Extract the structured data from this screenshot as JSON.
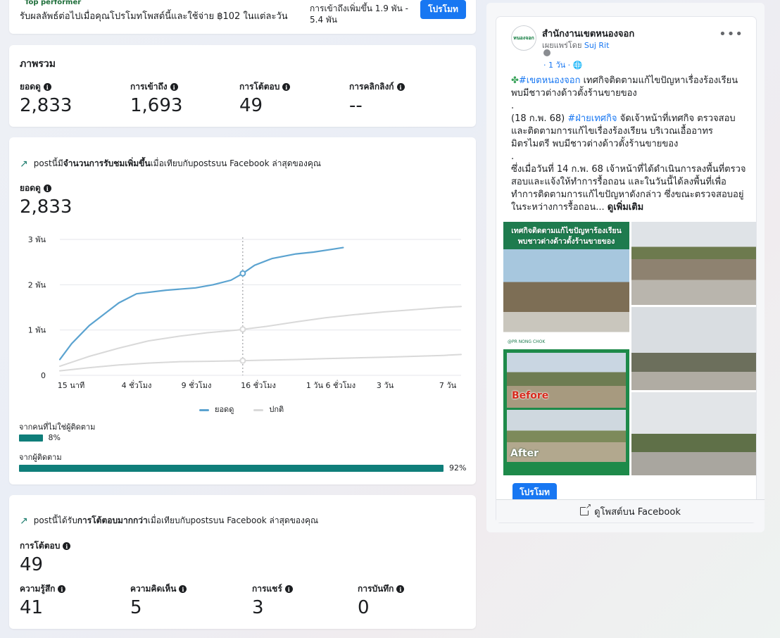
{
  "promo": {
    "tag": "Top performer",
    "text": "รับผลลัพธ์ต่อไปเมื่อคุณโปรโมทโพสต์นี้และใช้จ่าย ฿102 ในแต่ละวัน",
    "reach_line1": "การเข้าถึงเพิ่มขึ้น 1.9 พัน -",
    "reach_line2": "5.4 พัน",
    "button": "โปรโมท"
  },
  "overview": {
    "title": "ภาพรวม",
    "metrics": [
      {
        "label": "ยอดดู",
        "value": "2,833"
      },
      {
        "label": "การเข้าถึง",
        "value": "1,693"
      },
      {
        "label": "การโต้ตอบ",
        "value": "49"
      },
      {
        "label": "การคลิกลิงก์",
        "value": "--"
      }
    ]
  },
  "views_card": {
    "trend_pre": "postนี้มี",
    "trend_bold": "จำนวนการรับชมเพิ่มขึ้น",
    "trend_post": "เมื่อเทียบกับpostsบน Facebook ล่าสุดของคุณ",
    "metric_label": "ยอดดู",
    "metric_value": "2,833",
    "legend": {
      "series": "ยอดดู",
      "baseline": "ปกติ"
    },
    "non_followers_label": "จากคนที่ไม่ใช่ผู้ติดตาม",
    "non_followers_pct": "8%",
    "non_followers_value": 8,
    "followers_label": "จากผู้ติดตาม",
    "followers_pct": "92%",
    "followers_value": 92,
    "colors": {
      "series": "#5ba3d0",
      "baseline": "#d9d9d9",
      "bar": "#0f7e7a"
    }
  },
  "chart_data": {
    "type": "line",
    "x_tick_labels": [
      "15 นาที",
      "4 ชั่วโมง",
      "9 ชั่วโมง",
      "16 ชั่วโมง",
      "1 วัน 6 ชั่วโมง",
      "3 วัน",
      "7 วัน"
    ],
    "y_tick_labels": [
      "0",
      "1 พัน",
      "2 พัน",
      "3 พัน"
    ],
    "ylim": [
      0,
      3000
    ],
    "xlim": [
      0,
      6.8
    ],
    "series": [
      {
        "name": "ยอดดู",
        "x": [
          0,
          0.2,
          0.5,
          0.8,
          1.0,
          1.3,
          1.8,
          2.3,
          2.6,
          2.9,
          3.1,
          3.3,
          3.6,
          4.0,
          4.3,
          4.6,
          4.8
        ],
        "values": [
          350,
          700,
          1100,
          1400,
          1600,
          1800,
          1880,
          1930,
          2000,
          2100,
          2250,
          2430,
          2580,
          2680,
          2720,
          2780,
          2820
        ]
      },
      {
        "name": "ปกติ",
        "x": [
          0,
          0.5,
          1.0,
          1.5,
          2.0,
          2.5,
          3.0,
          3.5,
          4.0,
          4.5,
          5.0,
          5.5,
          6.0,
          6.5,
          6.8
        ],
        "values": [
          200,
          420,
          600,
          760,
          860,
          940,
          1000,
          1080,
          1180,
          1270,
          1340,
          1400,
          1450,
          1500,
          1520
        ]
      },
      {
        "name": "ปกติ",
        "x": [
          0,
          0.5,
          1.0,
          1.5,
          2.0,
          2.5,
          3.0,
          3.5,
          4.0,
          4.5,
          5.0,
          5.5,
          6.0,
          6.5,
          6.8
        ],
        "values": [
          100,
          170,
          230,
          270,
          300,
          310,
          320,
          335,
          350,
          370,
          385,
          400,
          420,
          440,
          460
        ]
      }
    ],
    "marker_x": 3.1
  },
  "engagement": {
    "trend_pre": "postนี้ได้รับ",
    "trend_bold": "การโต้ตอบมากกว่า",
    "trend_post": "เมื่อเทียบกับpostsบน Facebook ล่าสุดของคุณ",
    "metric_label": "การโต้ตอบ",
    "metric_value": "49",
    "metrics": [
      {
        "label": "ความรู้สึก",
        "value": "41"
      },
      {
        "label": "ความคิดเห็น",
        "value": "5"
      },
      {
        "label": "การแชร์",
        "value": "3"
      },
      {
        "label": "การบันทึก",
        "value": "0"
      }
    ]
  },
  "post": {
    "page_name": "สำนักงานเขตหนองจอก",
    "avatar_text": "หนองจอก",
    "published_by": "เผยแพร่โดย",
    "publisher": "Suj Rit",
    "time": "· 1 วัน ·",
    "para1_tag": "#เขตหนองจอก",
    "para1": " เทศกิจติดตามแก้ไขปัญหาเรื่องร้องเรียน พบมีชาวต่างด้าวตั้งร้านขายของ",
    "dot": ".",
    "para2_pre": "(18 ก.พ. 68) ",
    "para2_tag": "#ฝ่ายเทศกิจ",
    "para2": " จัดเจ้าหน้าที่เทศกิจ ตรวจสอบและติดตามการแก้ไขเรื่องร้องเรียน  บริเวณเอื้ออาทรมิตรไมตรี พบมีชาวต่างด้าวตั้งร้านขายของ",
    "para3": "ซึ่งเมื่อวันที่ 14 ก.พ. 68 เจ้าหน้าที่ได้ดำเนินการลงพื้นที่ตรวจสอบและแจ้งให้ทำการรื้อถอน และในวันนี้ได้ลงพื้นที่เพื่อทำการติดตามการแก้ไขปัญหาดังกล่าว ซึ่งขณะตรวจสอบอยู่ในระหว่างการรื้อถอน...",
    "see_more": "ดูเพิ่มเติม",
    "photo_headline": "เทศกิจติดตามแก้ไขปัญหาร้องเรียน พบชาวต่างด้าวตั้งร้านขายของ",
    "photo_footer": "@PR NONG CHOK",
    "before": "Before",
    "after": "After",
    "boost_button": "โปรโมท",
    "view_on_fb": "ดูโพสต์บน Facebook"
  }
}
